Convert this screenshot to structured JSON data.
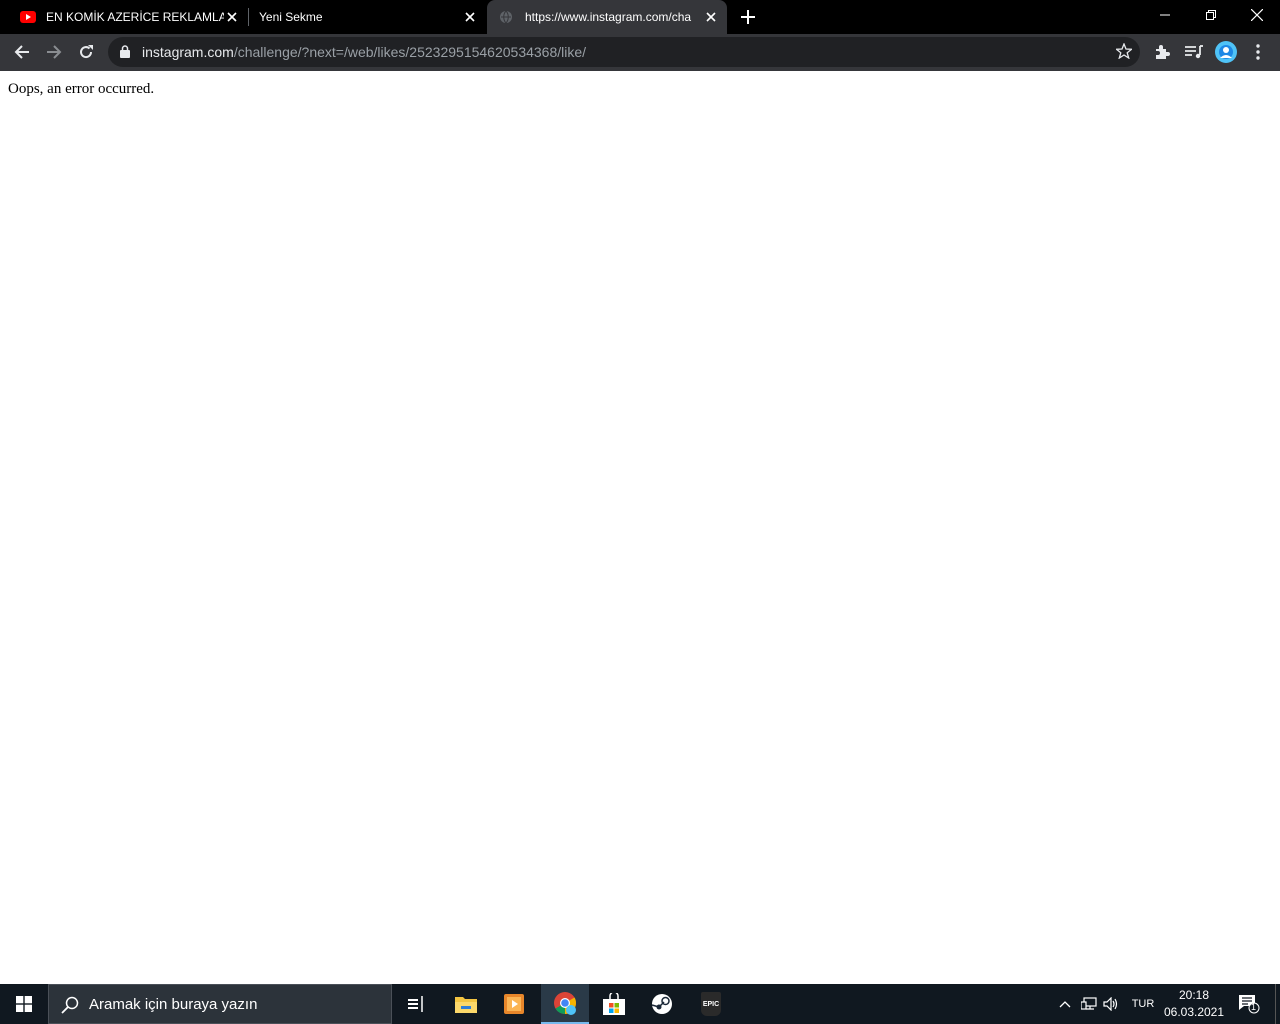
{
  "browser": {
    "tabs": [
      {
        "title": "EN KOMİK AZERİCE REKLAMLAR",
        "favicon": "youtube-icon"
      },
      {
        "title": "Yeni Sekme",
        "favicon": ""
      },
      {
        "title": "https://www.instagram.com/cha",
        "favicon": "globe-icon"
      }
    ],
    "active_tab_index": 2,
    "address": {
      "host": "instagram.com",
      "path": "/challenge/?next=/web/likes/2523295154620534368/like/"
    }
  },
  "page": {
    "message": "Oops, an error occurred."
  },
  "taskbar": {
    "search_placeholder": "Aramak için buraya yazın",
    "apps": [
      "task-view-icon",
      "file-explorer-icon",
      "media-player-icon",
      "chrome-icon",
      "store-icon",
      "steam-icon",
      "epic-games-icon"
    ],
    "epic_label": "EPIC",
    "language": "TUR",
    "time": "20:18",
    "date": "06.03.2021",
    "notification_count": "1"
  },
  "colors": {
    "tabbar_bg": "#000000",
    "toolbar_bg": "#35363a",
    "omnibox_bg": "#202124",
    "taskbar_bg": "#101820",
    "accent": "#76b9ed"
  }
}
